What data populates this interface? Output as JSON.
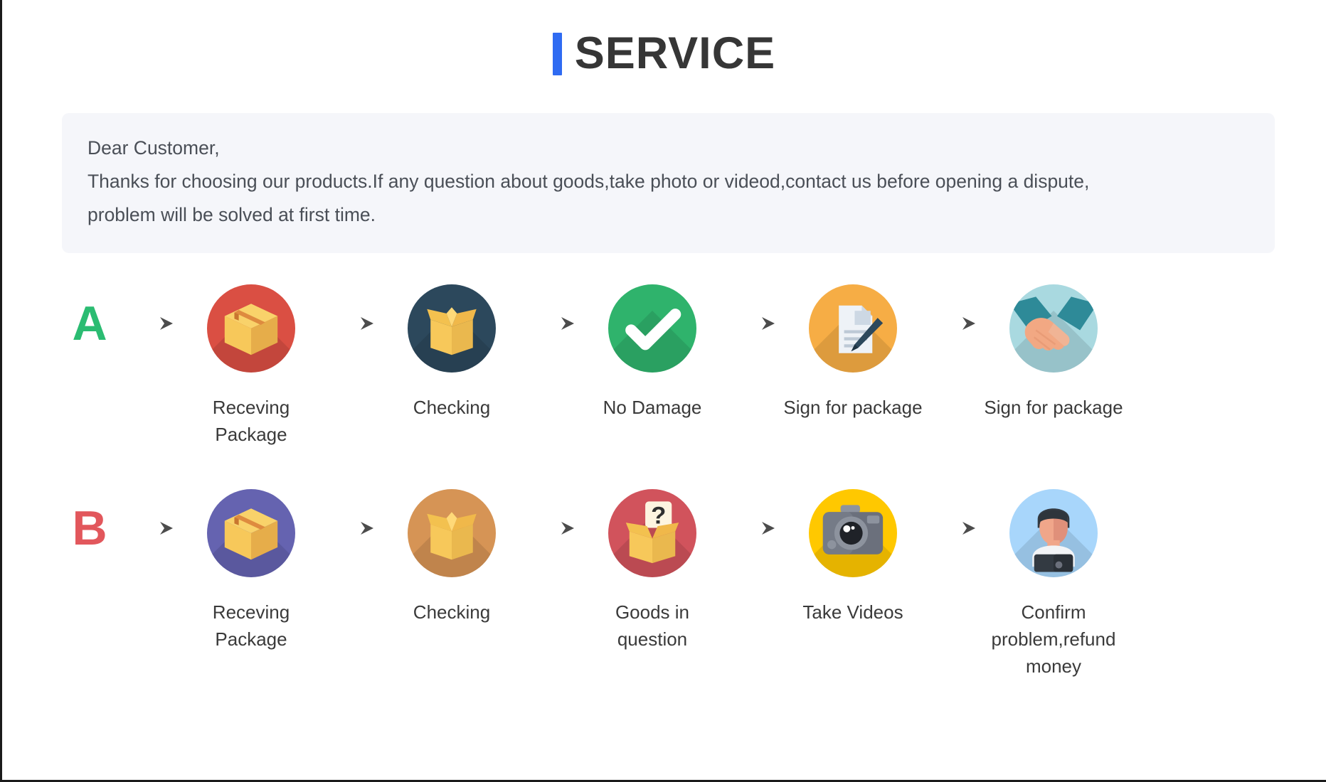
{
  "header": {
    "accent_color": "#2f6bf2",
    "title": "SERVICE"
  },
  "notice": {
    "background": "#f5f6fa",
    "line1": "Dear Customer,",
    "line2": "Thanks for choosing our products.If any question about goods,take photo or videod,contact us before opening a dispute,",
    "line3": "problem will be solved at first time."
  },
  "flows": [
    {
      "id": "flow-a",
      "letter": "A",
      "letter_color": "#2bbc72",
      "steps": [
        {
          "label": "Receving Package",
          "icon": "closed-box-icon",
          "circle_color": "#da4f43",
          "box_color": "#f7c85a"
        },
        {
          "label": "Checking",
          "icon": "open-box-icon",
          "circle_color": "#2c485c",
          "box_color": "#f7c85a"
        },
        {
          "label": "No Damage",
          "icon": "check-mark-icon",
          "circle_color": "#2fb36c",
          "box_color": "#ffffff"
        },
        {
          "label": "Sign for package",
          "icon": "document-pen-icon",
          "circle_color": "#f6ad45",
          "box_color": "#e4eaf0"
        },
        {
          "label": "Sign for package",
          "icon": "handshake-icon",
          "circle_color": "#a9d9e0",
          "box_color": "#f2a883"
        }
      ]
    },
    {
      "id": "flow-b",
      "letter": "B",
      "letter_color": "#e2575c",
      "steps": [
        {
          "label": "Receving Package",
          "icon": "closed-box-icon",
          "circle_color": "#6563b0",
          "box_color": "#f7c85a"
        },
        {
          "label": "Checking",
          "icon": "open-box-icon",
          "circle_color": "#d69455",
          "box_color": "#f7c85a"
        },
        {
          "label": "Goods in question",
          "icon": "question-box-icon",
          "circle_color": "#d1535c",
          "box_color": "#f7c85a"
        },
        {
          "label": "Take Videos",
          "icon": "camera-icon",
          "circle_color": "#ffc800",
          "box_color": "#6b707c"
        },
        {
          "label": "Confirm problem,refund money",
          "icon": "support-agent-icon",
          "circle_color": "#a8d6fb",
          "box_color": "#f0a68a"
        }
      ]
    }
  ],
  "arrow": {
    "icon": "arrow-right-icon",
    "color": "#4c4c4c"
  }
}
